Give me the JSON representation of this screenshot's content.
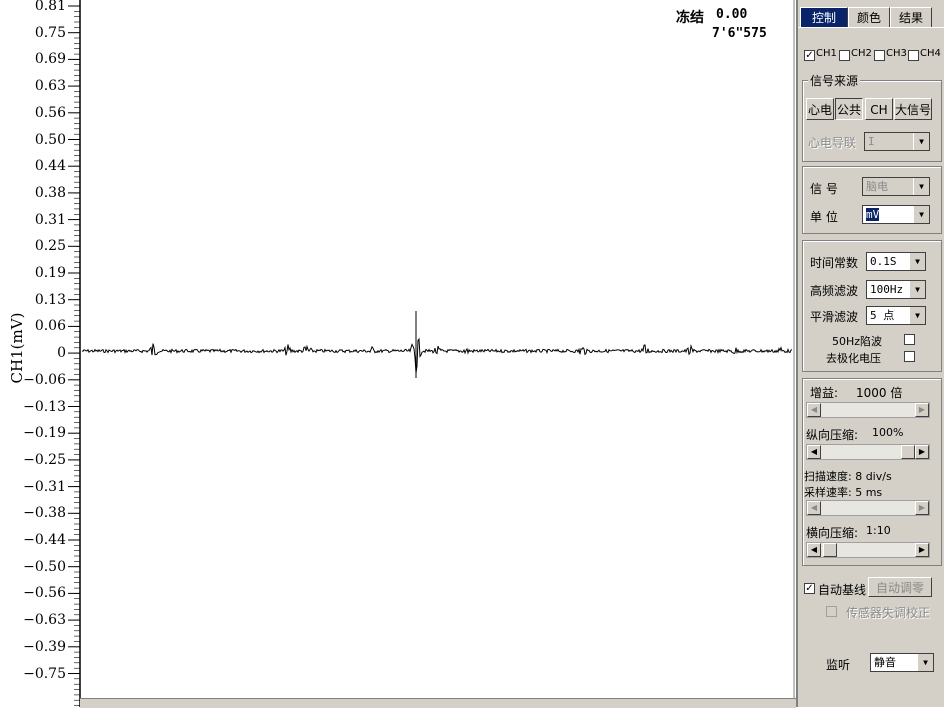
{
  "plot": {
    "y_axis_title": "CH1(mV)",
    "freeze_label": "冻结",
    "freeze_value": "0.00",
    "time_value": "7'6\"575",
    "y_tick_labels": [
      "0.81",
      "0.75",
      "0.69",
      "0.63",
      "0.56",
      "0.50",
      "0.44",
      "0.38",
      "0.31",
      "0.25",
      "0.19",
      "0.13",
      "0.06",
      "0",
      "−0.06",
      "−0.13",
      "−0.19",
      "−0.25",
      "−0.31",
      "−0.38",
      "−0.44",
      "−0.50",
      "−0.56",
      "−0.63",
      "−0.39",
      "−0.75"
    ]
  },
  "panel": {
    "tabs": [
      {
        "label": "控制",
        "active": true
      },
      {
        "label": "颜色",
        "active": false
      },
      {
        "label": "结果",
        "active": false
      }
    ],
    "channels": [
      {
        "label": "CH1",
        "checked": true
      },
      {
        "label": "CH2",
        "checked": false
      },
      {
        "label": "CH3",
        "checked": false
      },
      {
        "label": "CH4",
        "checked": false
      }
    ],
    "signal_source": {
      "title": "信号来源",
      "buttons": [
        "心电",
        "公共",
        "CH",
        "大信号"
      ],
      "ecg_lead_label": "心电导联",
      "ecg_lead_value": "I"
    },
    "signal": {
      "signal_label": "信  号",
      "signal_value": "脑电",
      "unit_label": "单  位",
      "unit_value": "mV"
    },
    "filters": {
      "time_constant_label": "时间常数",
      "time_constant_value": "0.1S",
      "high_freq_label": "高频滤波",
      "high_freq_value": "100Hz",
      "smooth_label": "平滑滤波",
      "smooth_value": "5 点",
      "notch_label": "50Hz陷波",
      "depol_label": "去极化电压"
    },
    "gain": {
      "gain_label": "增益:",
      "gain_value": "1000 倍",
      "vcomp_label": "纵向压缩:",
      "vcomp_value": "100%",
      "scan_speed": "扫描速度: 8 div/s",
      "sample_rate": "采样速率: 5 ms",
      "hcomp_label": "横向压缩:",
      "hcomp_value": "1:10"
    },
    "auto_baseline_label": "自动基线",
    "auto_zero_label": "自动调零",
    "sensor_calib_label": "传感器失调校正",
    "monitor_label": "监听",
    "monitor_value": "静音"
  }
}
